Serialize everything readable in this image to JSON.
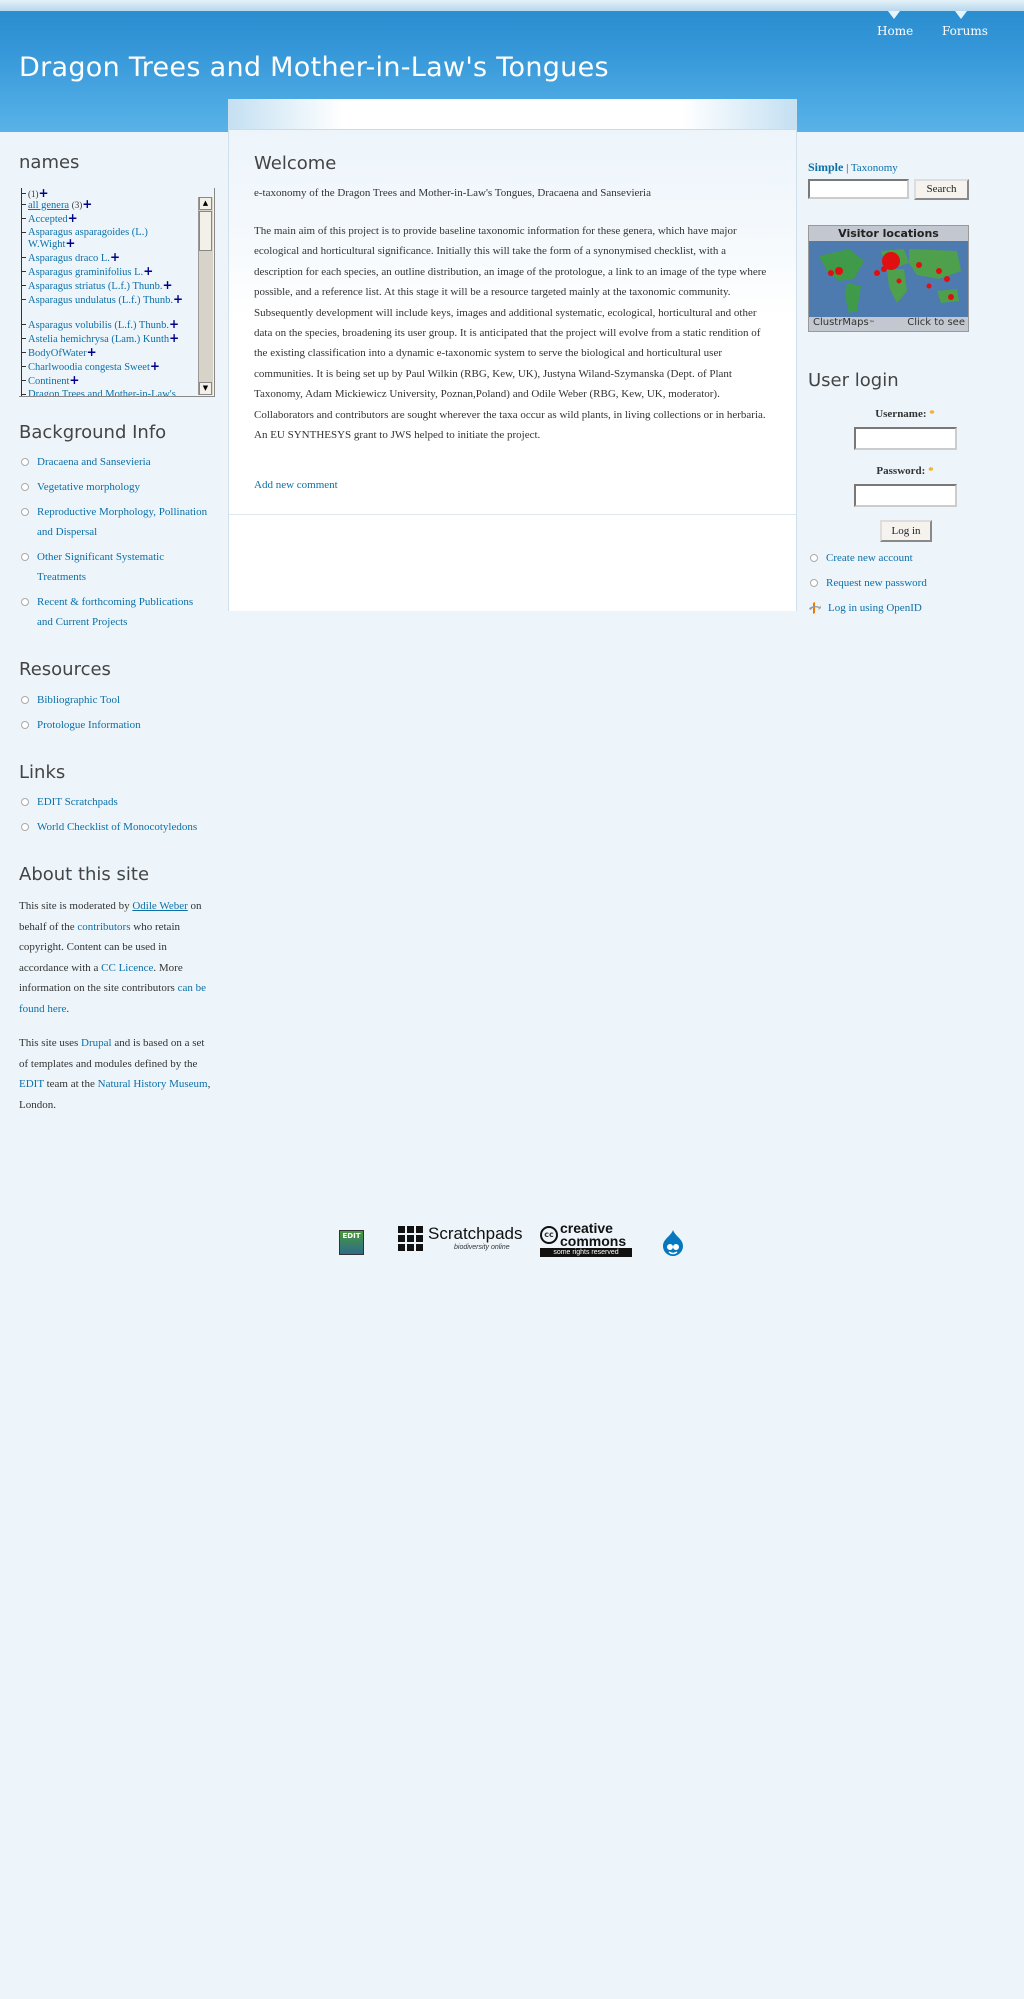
{
  "site": {
    "title": "Dragon Trees and Mother-in-Law's Tongues"
  },
  "nav": {
    "home": "Home",
    "forums": "Forums"
  },
  "names": {
    "title": "names",
    "items": [
      {
        "text": "",
        "suffix": "(1)"
      },
      {
        "text": "all genera",
        "suffix": "(3)"
      },
      {
        "text": "Accepted",
        "suffix": ""
      },
      {
        "text": "Asparagus asparagoides (L.) W.Wight",
        "suffix": ""
      },
      {
        "text": "Asparagus draco L.",
        "suffix": ""
      },
      {
        "text": "Asparagus graminifolius L.",
        "suffix": ""
      },
      {
        "text": "Asparagus striatus (L.f.) Thunb.",
        "suffix": ""
      },
      {
        "text": "Asparagus undulatus (L.f.) Thunb.",
        "suffix": ""
      },
      {
        "text": "Asparagus volubilis (L.f.) Thunb.",
        "suffix": ""
      },
      {
        "text": "Astelia hemichrysa (Lam.) Kunth",
        "suffix": ""
      },
      {
        "text": "BodyOfWater",
        "suffix": ""
      },
      {
        "text": "Charlwoodia congesta Sweet",
        "suffix": ""
      },
      {
        "text": "Continent",
        "suffix": ""
      },
      {
        "text": "Dragon Trees and Mother-in-Law's",
        "suffix": ""
      }
    ],
    "plus": "+"
  },
  "background": {
    "title": "Background Info",
    "items": [
      "Dracaena and Sansevieria",
      "Vegetative morphology",
      "Reproductive Morphology, Pollination and Dispersal",
      "Other Significant Systematic Treatments",
      "Recent & forthcoming Publications and Current Projects"
    ]
  },
  "resources": {
    "title": "Resources",
    "items": [
      "Bibliographic Tool",
      "Protologue Information"
    ]
  },
  "links": {
    "title": "Links",
    "items": [
      "EDIT Scratchpads",
      "World Checklist of Monocotyledons"
    ]
  },
  "about": {
    "title": "About this site",
    "p1": {
      "t1": "This site is moderated by ",
      "l1": "Odile Weber",
      "t2": " on behalf of the ",
      "l2": "contributors",
      "t3": " who retain copyright. Content can be used in accordance with a ",
      "l3": "CC Licence",
      "t4": ". More information on the site contributors ",
      "l4": "can be found here",
      "t5": "."
    },
    "p2": {
      "t1": "This site uses ",
      "l1": "Drupal",
      "t2": " and is based on a set of templates and modules defined by the ",
      "l2": "EDIT",
      "t3": " team at the ",
      "l3": "Natural History Museum",
      "t4": ", London."
    }
  },
  "main": {
    "title": "Welcome",
    "intro": "e-taxonomy of the Dragon Trees and Mother-in-Law's Tongues, Dracaena and Sansevieria",
    "body": "The main aim of this project is to provide baseline taxonomic information for these genera, which have major ecological and horticultural significance. Initially this will take the form of a synonymised checklist, with a description for each species, an outline distribution, an image of the protologue, a link to an image of the type where possible, and a reference list. At this stage it will be a resource targeted mainly at the taxonomic community. Subsequently development will include keys, images and additional systematic, ecological, horticultural and other data on the species, broadening its user group. It is anticipated that the project will evolve from a static rendition of the existing classification into a dynamic e-taxonomic system to serve the biological and horticultural user communities. It is being set up by Paul Wilkin (RBG, Kew, UK), Justyna Wiland-Szymanska (Dept. of Plant Taxonomy, Adam Mickiewicz University, Poznan,Poland) and Odile Weber (RBG, Kew, UK, moderator). Collaborators and contributors are sought wherever the taxa occur as wild plants, in living collections or in herbaria. An EU SYNTHESYS grant to JWS helped to initiate the project.",
    "add_comment": "Add new comment"
  },
  "search": {
    "tab_simple": "Simple",
    "sep": "|",
    "tab_taxonomy": "Taxonomy",
    "button": "Search"
  },
  "visitor_map": {
    "title": "Visitor locations",
    "brand": "ClustrMaps",
    "tm": "™",
    "cta": "Click to see"
  },
  "login": {
    "title": "User login",
    "username_label": "Username:",
    "password_label": "Password:",
    "required": "*",
    "button": "Log in",
    "links": [
      "Create new account",
      "Request new password",
      "Log in using OpenID"
    ]
  },
  "footer": {
    "edit_logo": "EDIT",
    "scratchpads": "Scratchpads",
    "scratchpads_sub": "biodiversity online",
    "cc_main": "creative commons",
    "cc_sub": "some rights reserved"
  }
}
